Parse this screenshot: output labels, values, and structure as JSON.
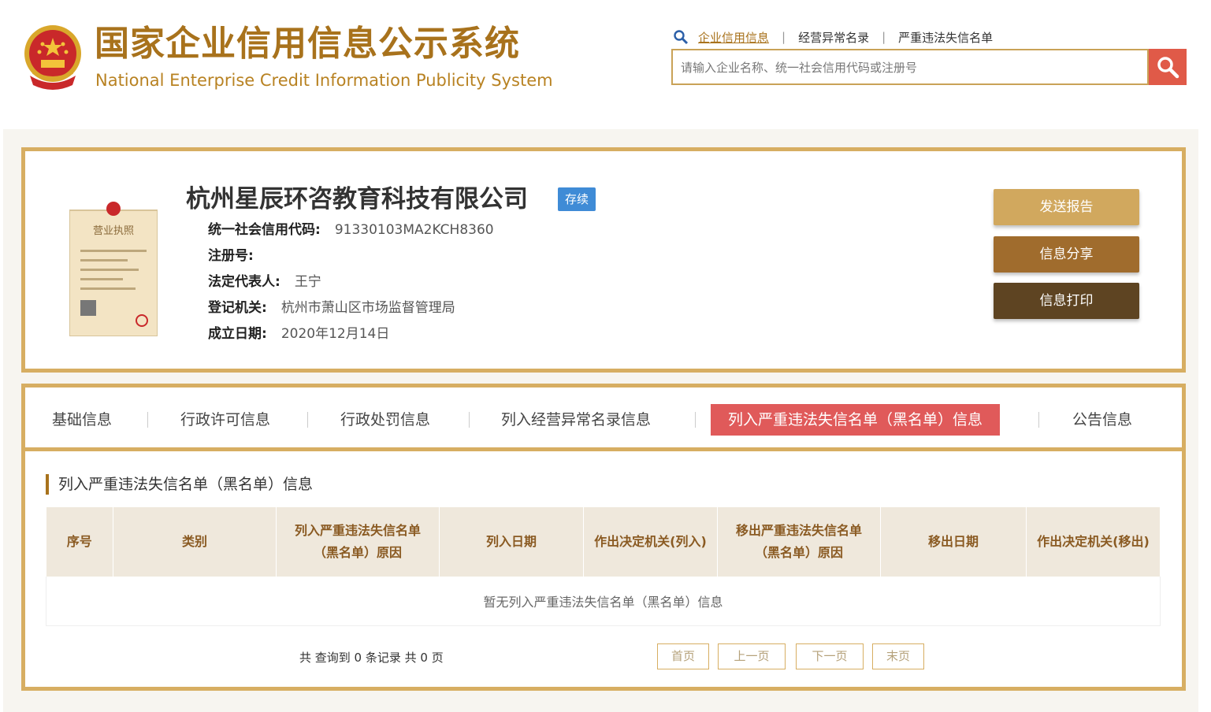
{
  "header": {
    "title_cn": "国家企业信用信息公示系统",
    "title_en": "National Enterprise Credit Information Publicity System",
    "links": [
      "企业信用信息",
      "经营异常名录",
      "严重违法失信名单"
    ],
    "search_placeholder": "请输入企业名称、统一社会信用代码或注册号"
  },
  "company": {
    "name": "杭州星辰环咨教育科技有限公司",
    "status": "存续",
    "license_title": "营业执照",
    "fields": [
      {
        "label": "统一社会信用代码:",
        "value": "91330103MA2KCH8360"
      },
      {
        "label": "注册号:",
        "value": ""
      },
      {
        "label": "法定代表人:",
        "value": "王宁"
      },
      {
        "label": "登记机关:",
        "value": "杭州市萧山区市场监督管理局"
      },
      {
        "label": "成立日期:",
        "value": "2020年12月14日"
      }
    ]
  },
  "actions": [
    "发送报告",
    "信息分享",
    "信息打印"
  ],
  "tabs": [
    "基础信息",
    "行政许可信息",
    "行政处罚信息",
    "列入经营异常名录信息",
    "列入严重违法失信名单（黑名单）信息",
    "公告信息"
  ],
  "active_tab": "列入严重违法失信名单（黑名单）信息",
  "section": {
    "title": "列入严重违法失信名单（黑名单）信息",
    "columns": [
      "序号",
      "类别",
      "列入严重违法失信名单（黑名单）原因",
      "列入日期",
      "作出决定机关(列入)",
      "移出严重违法失信名单（黑名单）原因",
      "移出日期",
      "作出决定机关(移出)"
    ],
    "empty_text": "暂无列入严重违法失信名单（黑名单）信息",
    "pager_info": "共 查询到 0 条记录 共 0 页",
    "pager": [
      "首页",
      "上一页",
      "下一页",
      "末页"
    ]
  },
  "colors": {
    "gold": "#d7ae62",
    "brown": "#a8721c",
    "active_tab": "#e05a5a",
    "badge": "#3f8bd6"
  }
}
